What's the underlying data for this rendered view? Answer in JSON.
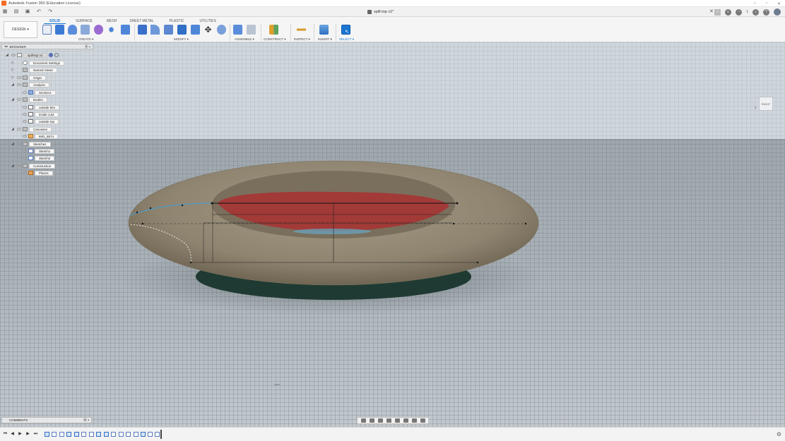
{
  "app": {
    "title": "Autodesk Fusion 360 (Education License)",
    "document_tab": "spill-top v1*",
    "notification_count": "1"
  },
  "ribbon": {
    "workspace": "DESIGN",
    "tabs": [
      "SOLID",
      "SURFACE",
      "MESH",
      "SHEET METAL",
      "PLASTIC",
      "UTILITIES"
    ],
    "active_tab": "SOLID",
    "groups": [
      "CREATE",
      "MODIFY",
      "ASSEMBLE",
      "CONSTRUCT",
      "INSPECT",
      "INSERT",
      "SELECT"
    ]
  },
  "browser": {
    "title": "BROWSER",
    "root": "spill-top v1",
    "items": [
      {
        "label": "Document Settings",
        "icon": "gear-icon",
        "level": 1,
        "expanded": false
      },
      {
        "label": "Named Views",
        "icon": "folder-icon",
        "level": 1,
        "expanded": false
      },
      {
        "label": "Origin",
        "icon": "folder-icon",
        "level": 1,
        "expanded": false
      },
      {
        "label": "Analysis",
        "icon": "folder-icon",
        "level": 1,
        "expanded": true
      },
      {
        "label": "Section1",
        "icon": "section-icon",
        "level": 2
      },
      {
        "label": "Bodies",
        "icon": "folder-icon",
        "level": 1,
        "expanded": true
      },
      {
        "label": "outside btm",
        "icon": "body-icon",
        "level": 2
      },
      {
        "label": "inside cut2",
        "icon": "body-icon",
        "level": 2
      },
      {
        "label": "outside top",
        "icon": "body-icon",
        "level": 2
      },
      {
        "label": "Canvases",
        "icon": "folder-icon",
        "level": 1,
        "expanded": true
      },
      {
        "label": "IMG_5574",
        "icon": "canvas-icon",
        "level": 2
      },
      {
        "label": "Sketches",
        "icon": "folder-icon",
        "level": 1,
        "expanded": true
      },
      {
        "label": "Sketch1",
        "icon": "sketch-icon",
        "level": 2
      },
      {
        "label": "Sketch2",
        "icon": "sketch-icon",
        "level": 2
      },
      {
        "label": "Construction",
        "icon": "folder-icon",
        "level": 1,
        "expanded": true
      },
      {
        "label": "Plane1",
        "icon": "plane-icon",
        "level": 2
      }
    ]
  },
  "viewcube": {
    "face": "RIGHT"
  },
  "comments": {
    "title": "COMMENTS"
  },
  "colors": {
    "accent": "#1b76d2",
    "model_body": "#9b8d74",
    "section_red": "#a23a38",
    "base_dark": "#1f3a32",
    "sketch_line": "#3fa0d8"
  }
}
